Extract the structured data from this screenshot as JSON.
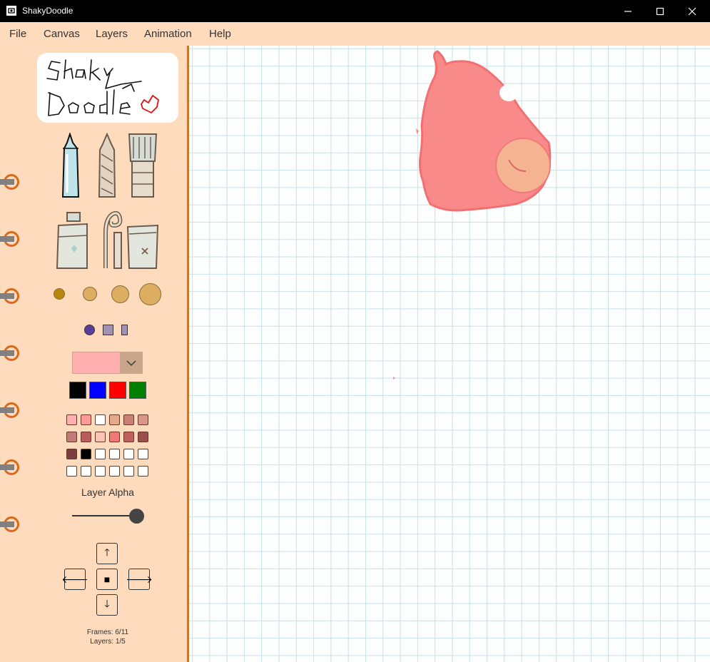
{
  "window": {
    "title": "ShakyDoodle",
    "controls": [
      "minimize-icon",
      "maximize-icon",
      "close-icon"
    ]
  },
  "menu": [
    "File",
    "Canvas",
    "Layers",
    "Animation",
    "Help"
  ],
  "logo": {
    "text": "ShakyDoodle"
  },
  "tools": {
    "row1": [
      "marker-icon",
      "pencil-icon",
      "brush-icon"
    ],
    "row2": [
      "spray-can-icon",
      "shake-spiral-icon",
      "eraser-tube-icon"
    ]
  },
  "brush_sizes": [
    "size-1",
    "size-2",
    "size-3",
    "size-4"
  ],
  "brush_shapes": [
    "circle-icon",
    "square-icon",
    "rectangle-icon"
  ],
  "selected_color": "#ffb1b1",
  "quick_colors": [
    "#000000",
    "#0000ff",
    "#ff0000",
    "#008000"
  ],
  "palette": [
    [
      "#ffb1b1",
      "#ff9a9a",
      "#ffffff",
      "#e4a88c",
      "#c77f78",
      "#d9958a"
    ],
    [
      "#c07a78",
      "#b85c5c",
      "#f9c4b6",
      "#ee7a78",
      "#c0605e",
      "#9a4e4e"
    ],
    [
      "#7a3e3e",
      "#000000",
      "#ffffff",
      "#ffffff",
      "#ffffff",
      "#ffffff"
    ],
    [
      "#ffffff",
      "#ffffff",
      "#ffffff",
      "#ffffff",
      "#ffffff",
      "#ffffff"
    ]
  ],
  "layer_alpha": {
    "label": "Layer Alpha",
    "value": 1.0
  },
  "navigation": {
    "up": "🡑",
    "left": "🡐",
    "stop": "■",
    "right": "🡒",
    "down": "🡓"
  },
  "status": {
    "frames": "Frames: 6/11",
    "layers": "Layers: 1/5"
  },
  "colors": {
    "menu_bg": "#ffdbbd",
    "accent_border": "#cc7730",
    "grid_line": "#c9e0ea",
    "blob": "#f88a8a"
  }
}
